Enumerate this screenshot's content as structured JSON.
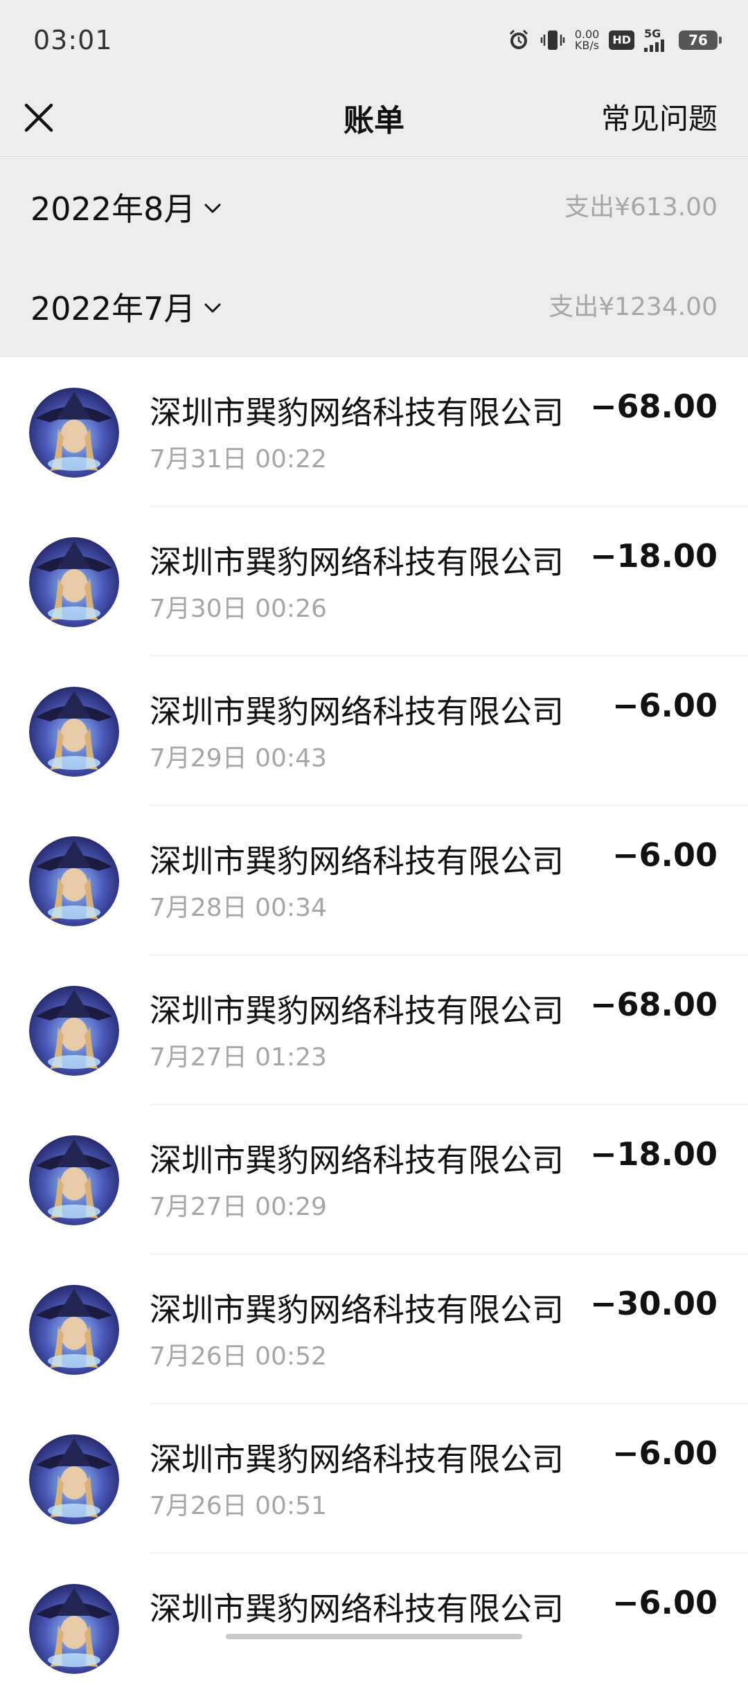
{
  "status_bar": {
    "time": "03:01",
    "net_speed_value": "0.00",
    "net_speed_unit": "KB/s",
    "hd_badge": "HD",
    "signal_label": "5G",
    "battery_level": "76"
  },
  "header": {
    "title": "账单",
    "faq": "常见问题",
    "close_icon": "close-icon"
  },
  "months": [
    {
      "label": "2022年8月",
      "total": "支出¥613.00"
    },
    {
      "label": "2022年7月",
      "total": "支出¥1234.00"
    }
  ],
  "transactions": [
    {
      "merchant": "深圳市巽豹网络科技有限公司",
      "time": "7月31日 00:22",
      "amount": "−68.00"
    },
    {
      "merchant": "深圳市巽豹网络科技有限公司",
      "time": "7月30日 00:26",
      "amount": "−18.00"
    },
    {
      "merchant": "深圳市巽豹网络科技有限公司",
      "time": "7月29日 00:43",
      "amount": "−6.00"
    },
    {
      "merchant": "深圳市巽豹网络科技有限公司",
      "time": "7月28日 00:34",
      "amount": "−6.00"
    },
    {
      "merchant": "深圳市巽豹网络科技有限公司",
      "time": "7月27日 01:23",
      "amount": "−68.00"
    },
    {
      "merchant": "深圳市巽豹网络科技有限公司",
      "time": "7月27日 00:29",
      "amount": "−18.00"
    },
    {
      "merchant": "深圳市巽豹网络科技有限公司",
      "time": "7月26日 00:52",
      "amount": "−30.00"
    },
    {
      "merchant": "深圳市巽豹网络科技有限公司",
      "time": "7月26日 00:51",
      "amount": "−6.00"
    },
    {
      "merchant": "深圳市巽豹网络科技有限公司",
      "time": "",
      "amount": "−6.00"
    }
  ],
  "colors": {
    "background_gray": "#ededed",
    "muted_text": "#a6a6a6",
    "primary_text": "#111111"
  }
}
